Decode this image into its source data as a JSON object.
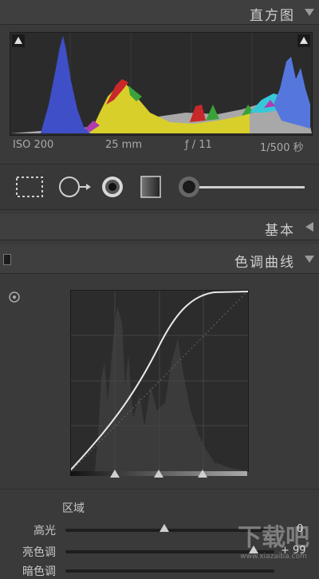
{
  "histogram_panel": {
    "title": "直方图",
    "meta": {
      "iso": "ISO 200",
      "focal": "25 mm",
      "aperture": "ƒ / 11",
      "shutter": "1/500 秒"
    }
  },
  "tools": {
    "items": [
      {
        "name": "crop-overlay-icon"
      },
      {
        "name": "spot-removal-icon"
      },
      {
        "name": "red-eye-icon"
      },
      {
        "name": "graduated-filter-icon"
      },
      {
        "name": "adjustment-brush-icon"
      }
    ]
  },
  "basic_panel": {
    "title": "基本"
  },
  "tone_curve_panel": {
    "title": "色调曲线",
    "region_label": "区域",
    "sliders": [
      {
        "label": "高光",
        "value": "0",
        "level": 0
      },
      {
        "label": "亮色调",
        "value": "+ 99",
        "level": 99
      },
      {
        "label": "暗色调",
        "value": "",
        "level": 0
      }
    ],
    "split_points": [
      0.25,
      0.5,
      0.75
    ]
  },
  "watermark": {
    "text": "下载吧",
    "subtext": "www.xiazaiba.com"
  },
  "colors": {
    "background": "#3a3a3a",
    "header": "#3f3f3f",
    "histogram_bg": "#2b2b2b"
  }
}
